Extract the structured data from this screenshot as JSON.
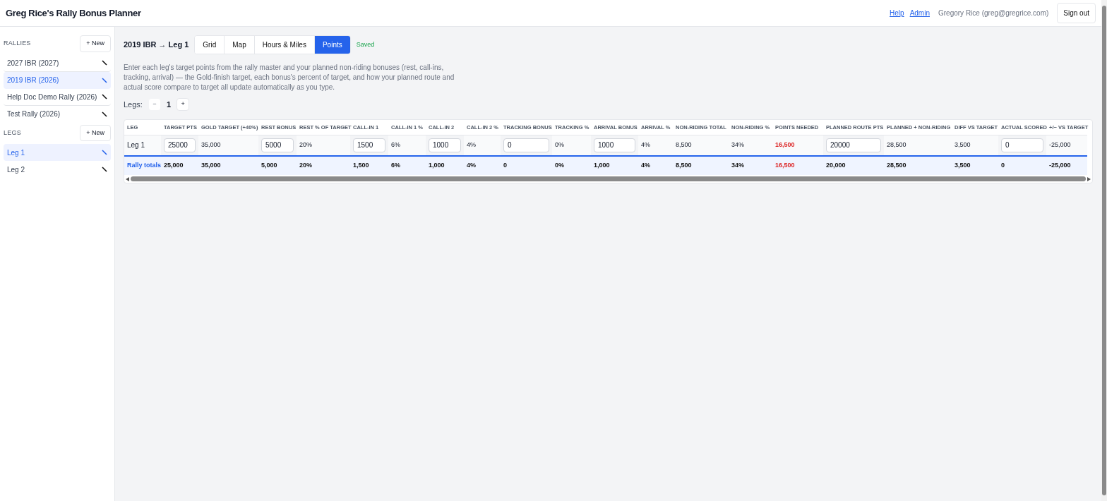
{
  "app_title": "Greg Rice's Rally Bonus Planner",
  "header": {
    "links": [
      "Help",
      "Admin"
    ],
    "user": "Gregory Rice (greg@gregrice.com)",
    "sign_out": "Sign out"
  },
  "sidebar": {
    "sections": [
      {
        "heading": "RALLIES",
        "new_button": "+ New",
        "items": [
          {
            "label": "2027 IBR (2027)",
            "selected": false
          },
          {
            "label": "2019 IBR (2026)",
            "selected": true
          },
          {
            "label": "Help Doc Demo Rally (2026)",
            "selected": false
          },
          {
            "label": "Test Rally (2026)",
            "selected": false
          }
        ]
      },
      {
        "heading": "LEGS",
        "new_button": "+ New",
        "items": [
          {
            "label": "Leg 1",
            "selected": true
          },
          {
            "label": "Leg 2",
            "selected": false
          }
        ]
      }
    ]
  },
  "breadcrumb": "2019 IBR → Leg 1",
  "tabs": [
    {
      "label": "Grid",
      "selected": false
    },
    {
      "label": "Map",
      "selected": false
    },
    {
      "label": "Hours & Miles",
      "selected": false
    },
    {
      "label": "Points",
      "selected": true
    }
  ],
  "save_status": "Saved",
  "description": "Enter each leg's target points from the rally master and your planned non-riding bonuses (rest, call-ins, tracking, arrival) — the Gold-finish target, each bonus's percent of target, and how your planned route and actual score compare to target all update automatically as you type.",
  "legs_stepper": {
    "label": "Legs:",
    "decrement": "−",
    "value": "1",
    "increment": "+"
  },
  "table": {
    "columns": [
      {
        "header": "LEG",
        "kind": "text",
        "alert": false,
        "row": "Leg 1",
        "total": "Rally totals"
      },
      {
        "header": "TARGET PTS",
        "kind": "input",
        "alert": false,
        "row": "25000",
        "total": "25,000"
      },
      {
        "header": "GOLD TARGET (+40%)",
        "kind": "text",
        "alert": false,
        "row": "35,000",
        "total": "35,000"
      },
      {
        "header": "REST BONUS",
        "kind": "input",
        "alert": false,
        "row": "5000",
        "total": "5,000"
      },
      {
        "header": "REST % OF TARGET",
        "kind": "text",
        "alert": false,
        "row": "20%",
        "total": "20%"
      },
      {
        "header": "CALL-IN 1",
        "kind": "input",
        "alert": false,
        "row": "1500",
        "total": "1,500"
      },
      {
        "header": "CALL-IN 1 %",
        "kind": "text",
        "alert": false,
        "row": "6%",
        "total": "6%"
      },
      {
        "header": "CALL-IN 2",
        "kind": "input",
        "alert": false,
        "row": "1000",
        "total": "1,000"
      },
      {
        "header": "CALL-IN 2 %",
        "kind": "text",
        "alert": false,
        "row": "4%",
        "total": "4%"
      },
      {
        "header": "TRACKING BONUS",
        "kind": "input",
        "alert": false,
        "row": "0",
        "total": "0"
      },
      {
        "header": "TRACKING %",
        "kind": "text",
        "alert": false,
        "row": "0%",
        "total": "0%"
      },
      {
        "header": "ARRIVAL BONUS",
        "kind": "input",
        "alert": false,
        "row": "1000",
        "total": "1,000"
      },
      {
        "header": "ARRIVAL %",
        "kind": "text",
        "alert": false,
        "row": "4%",
        "total": "4%"
      },
      {
        "header": "NON-RIDING TOTAL",
        "kind": "text",
        "alert": false,
        "row": "8,500",
        "total": "8,500"
      },
      {
        "header": "NON-RIDING %",
        "kind": "text",
        "alert": false,
        "row": "34%",
        "total": "34%"
      },
      {
        "header": "POINTS NEEDED",
        "kind": "text",
        "alert": true,
        "row": "16,500",
        "total": "16,500"
      },
      {
        "header": "PLANNED ROUTE PTS",
        "kind": "input",
        "alert": false,
        "row": "20000",
        "total": "20,000"
      },
      {
        "header": "PLANNED + NON-RIDING",
        "kind": "text",
        "alert": false,
        "row": "28,500",
        "total": "28,500"
      },
      {
        "header": "DIFF VS TARGET",
        "kind": "text",
        "alert": false,
        "row": "3,500",
        "total": "3,500"
      },
      {
        "header": "ACTUAL SCORED",
        "kind": "input",
        "alert": false,
        "row": "0",
        "total": "0"
      },
      {
        "header": "+/− VS TARGET",
        "kind": "text",
        "alert": false,
        "row": "-25,000",
        "total": "-25,000"
      }
    ]
  }
}
